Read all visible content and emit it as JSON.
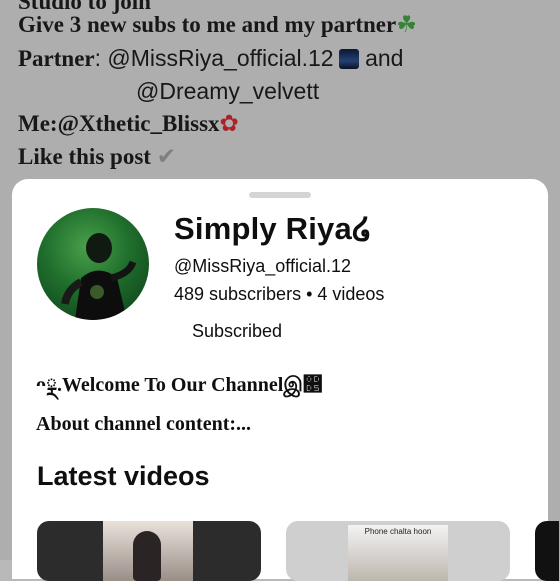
{
  "post": {
    "line0": "Studio to join",
    "line1": "Give 3 new subs to me and my partner",
    "line2_label": "Partner",
    "line2_handle": ": @MissRiya_official.12",
    "line2_and": "and",
    "line3_handle": "@Dreamy_velvett",
    "line4": "Me:@Xthetic_Blissx",
    "line5": "Like this post"
  },
  "channel": {
    "name": "Simply Riya໒",
    "handle": "@MissRiya_official.12",
    "stats": "489 subscribers • 4 videos",
    "subscribe_label": "Subscribed",
    "welcome": "ᴖྼ.Welcome To Our Channelஇ෕",
    "about": "About channel content:..."
  },
  "latest": {
    "title": "Latest videos",
    "videos": [
      {
        "caption": ""
      },
      {
        "caption": "Phone chalta hoon"
      }
    ]
  },
  "icons": {
    "clover": "four-leaf-clover-icon",
    "rose": "rose-icon",
    "check": "check-icon",
    "night": "night-sky-icon"
  }
}
